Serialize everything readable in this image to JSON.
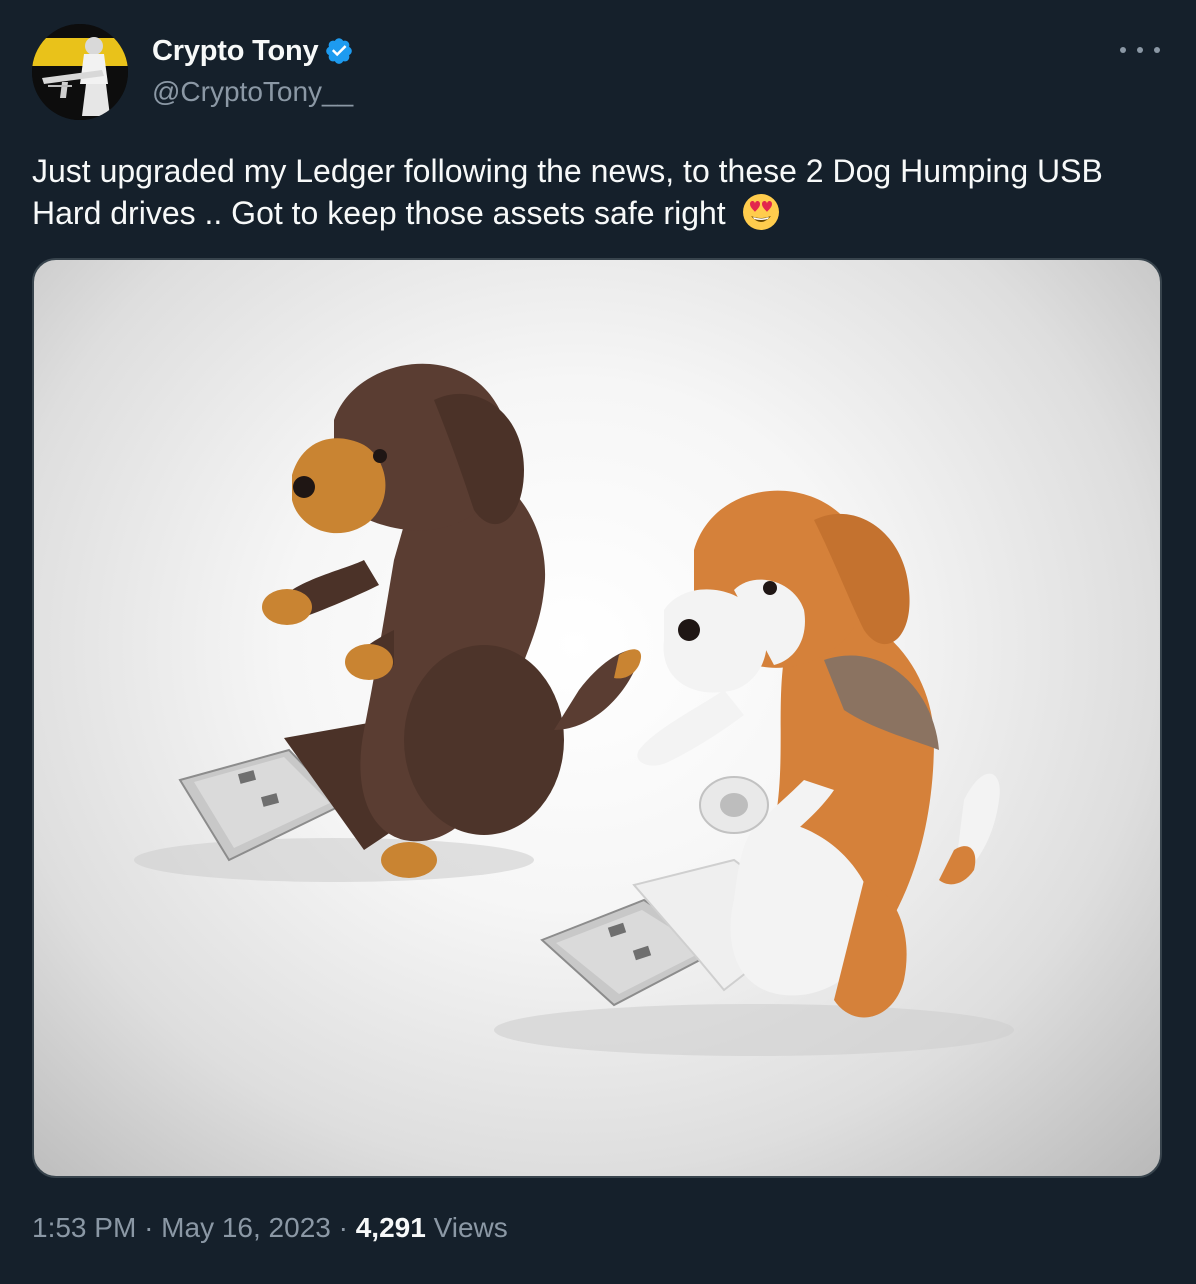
{
  "author": {
    "display_name": "Crypto Tony",
    "handle": "@CryptoTony__",
    "verified": true,
    "verified_color": "#1d9bf0",
    "avatar_icon": "avatar-icon"
  },
  "menu": {
    "more_icon": "more-dots-icon"
  },
  "tweet": {
    "text": "Just upgraded my Ledger following the news, to these 2 Dog Humping USB Hard drives .. Got to keep those assets safe right",
    "emoji": "heart-eyes-emoji"
  },
  "media": {
    "kind": "photo"
  },
  "meta": {
    "time": "1:53 PM",
    "separator": "·",
    "date": "May 16, 2023",
    "views_count": "4,291",
    "views_label": "Views"
  },
  "colors": {
    "background": "#15202b",
    "text_primary": "#f7f9f9",
    "text_secondary": "#8b98a5",
    "border": "#38444d"
  }
}
